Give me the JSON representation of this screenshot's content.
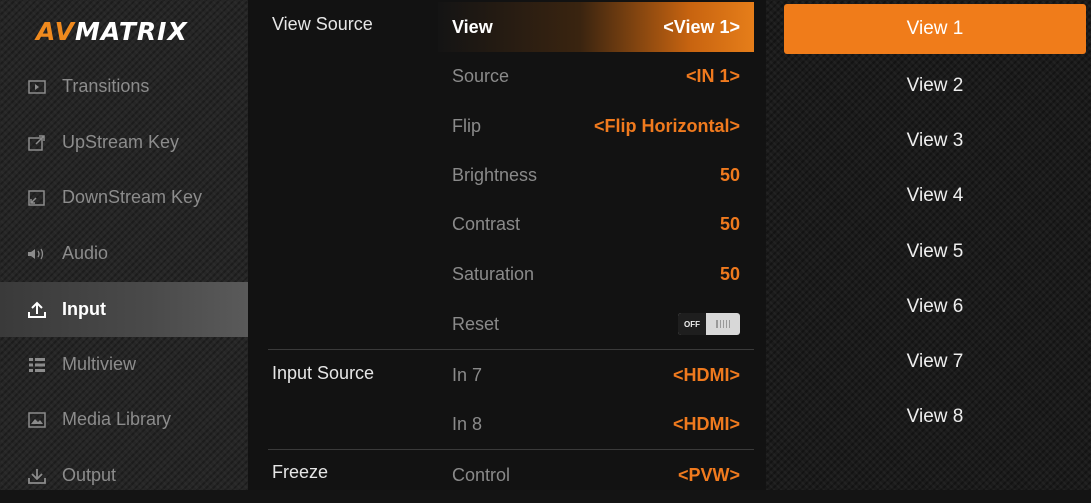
{
  "logo": {
    "part1": "AV",
    "part2": "MATRIX"
  },
  "sidebar": {
    "items": [
      {
        "label": "Transitions",
        "icon": "transitions-icon"
      },
      {
        "label": "UpStream Key",
        "icon": "upstream-key-icon"
      },
      {
        "label": "DownStream Key",
        "icon": "downstream-key-icon"
      },
      {
        "label": "Audio",
        "icon": "speaker-icon"
      },
      {
        "label": "Input",
        "icon": "upload-icon",
        "active": true
      },
      {
        "label": "Multiview",
        "icon": "list-icon"
      },
      {
        "label": "Media Library",
        "icon": "image-icon"
      },
      {
        "label": "Output",
        "icon": "download-icon"
      }
    ]
  },
  "panel": {
    "sections": {
      "view_source": "View Source",
      "input_source": "Input Source",
      "freeze": "Freeze"
    },
    "rows": {
      "view": {
        "label": "View",
        "value": "<View 1>"
      },
      "source": {
        "label": "Source",
        "value": "<IN 1>"
      },
      "flip": {
        "label": "Flip",
        "value": "<Flip Horizontal>"
      },
      "brightness": {
        "label": "Brightness",
        "value": "50"
      },
      "contrast": {
        "label": "Contrast",
        "value": "50"
      },
      "saturation": {
        "label": "Saturation",
        "value": "50"
      },
      "reset": {
        "label": "Reset",
        "toggle_text": "OFF"
      },
      "in7": {
        "label": "In 7",
        "value": "<HDMI>"
      },
      "in8": {
        "label": "In 8",
        "value": "<HDMI>"
      },
      "control": {
        "label": "Control",
        "value": "<PVW>"
      }
    }
  },
  "views": [
    "View 1",
    "View 2",
    "View 3",
    "View 4",
    "View 5",
    "View 6",
    "View 7",
    "View 8"
  ],
  "colors": {
    "accent": "#f07c1a",
    "value_text": "#f07a1e"
  }
}
